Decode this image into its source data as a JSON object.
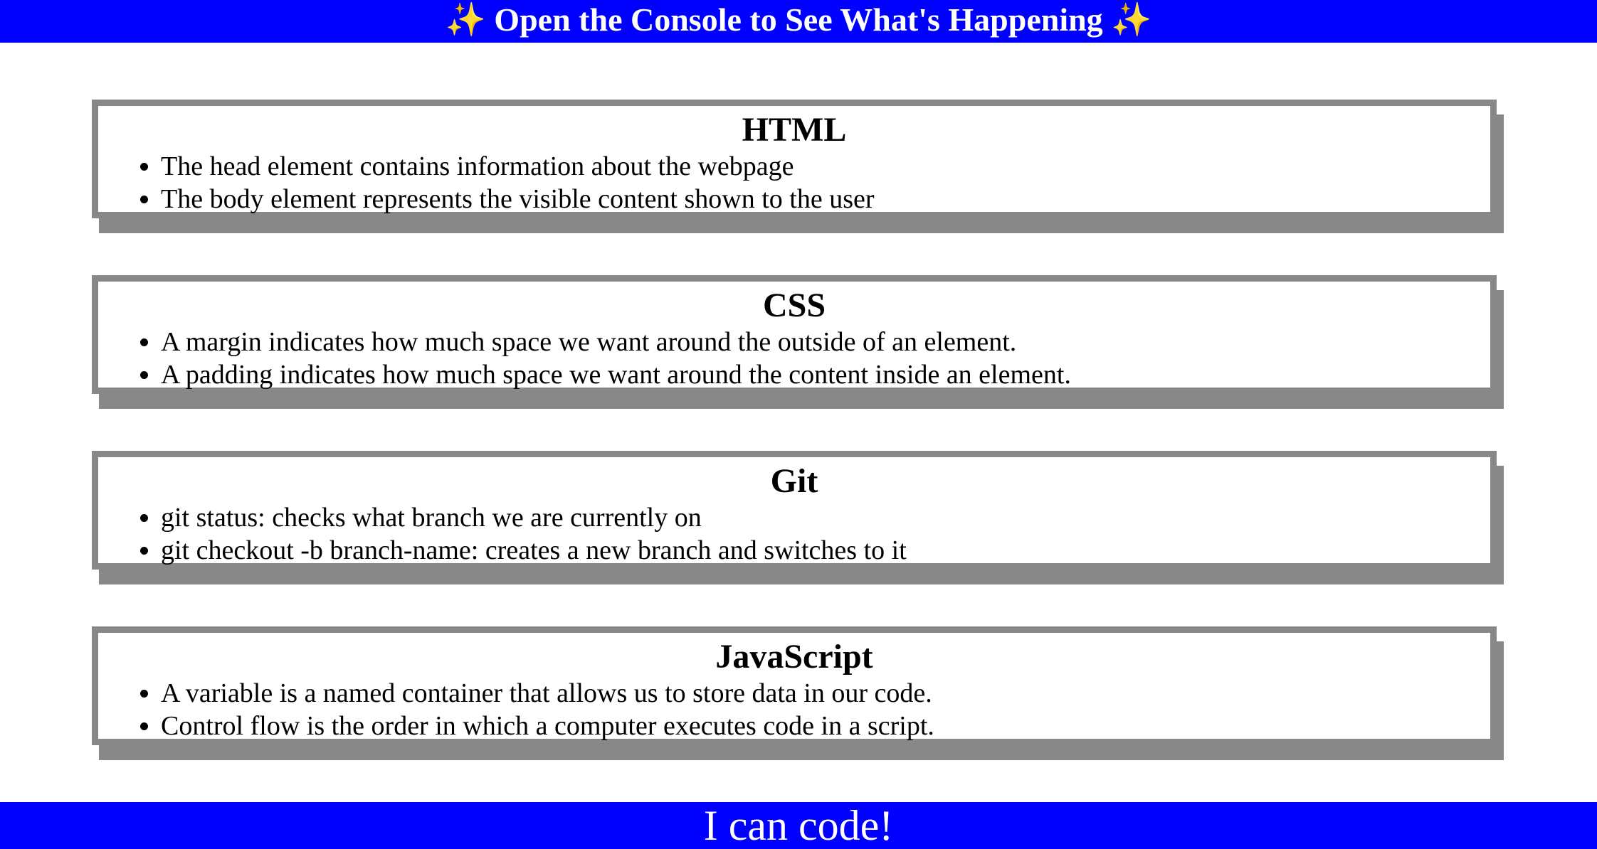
{
  "header": {
    "title": "✨ Open the Console to See What's Happening ✨"
  },
  "sections": [
    {
      "title": "HTML",
      "items": [
        "The head element contains information about the webpage",
        "The body element represents the visible content shown to the user"
      ]
    },
    {
      "title": "CSS",
      "items": [
        "A margin indicates how much space we want around the outside of an element.",
        "A padding indicates how much space we want around the content inside an element."
      ]
    },
    {
      "title": "Git",
      "items": [
        "git status: checks what branch we are currently on",
        "git checkout -b branch-name: creates a new branch and switches to it"
      ]
    },
    {
      "title": "JavaScript",
      "items": [
        "A variable is a named container that allows us to store data in our code.",
        "Control flow is the order in which a computer executes code in a script."
      ]
    }
  ],
  "footer": {
    "text": "I can code!"
  },
  "colors": {
    "banner": "#0000ff",
    "card_border": "#888888"
  }
}
